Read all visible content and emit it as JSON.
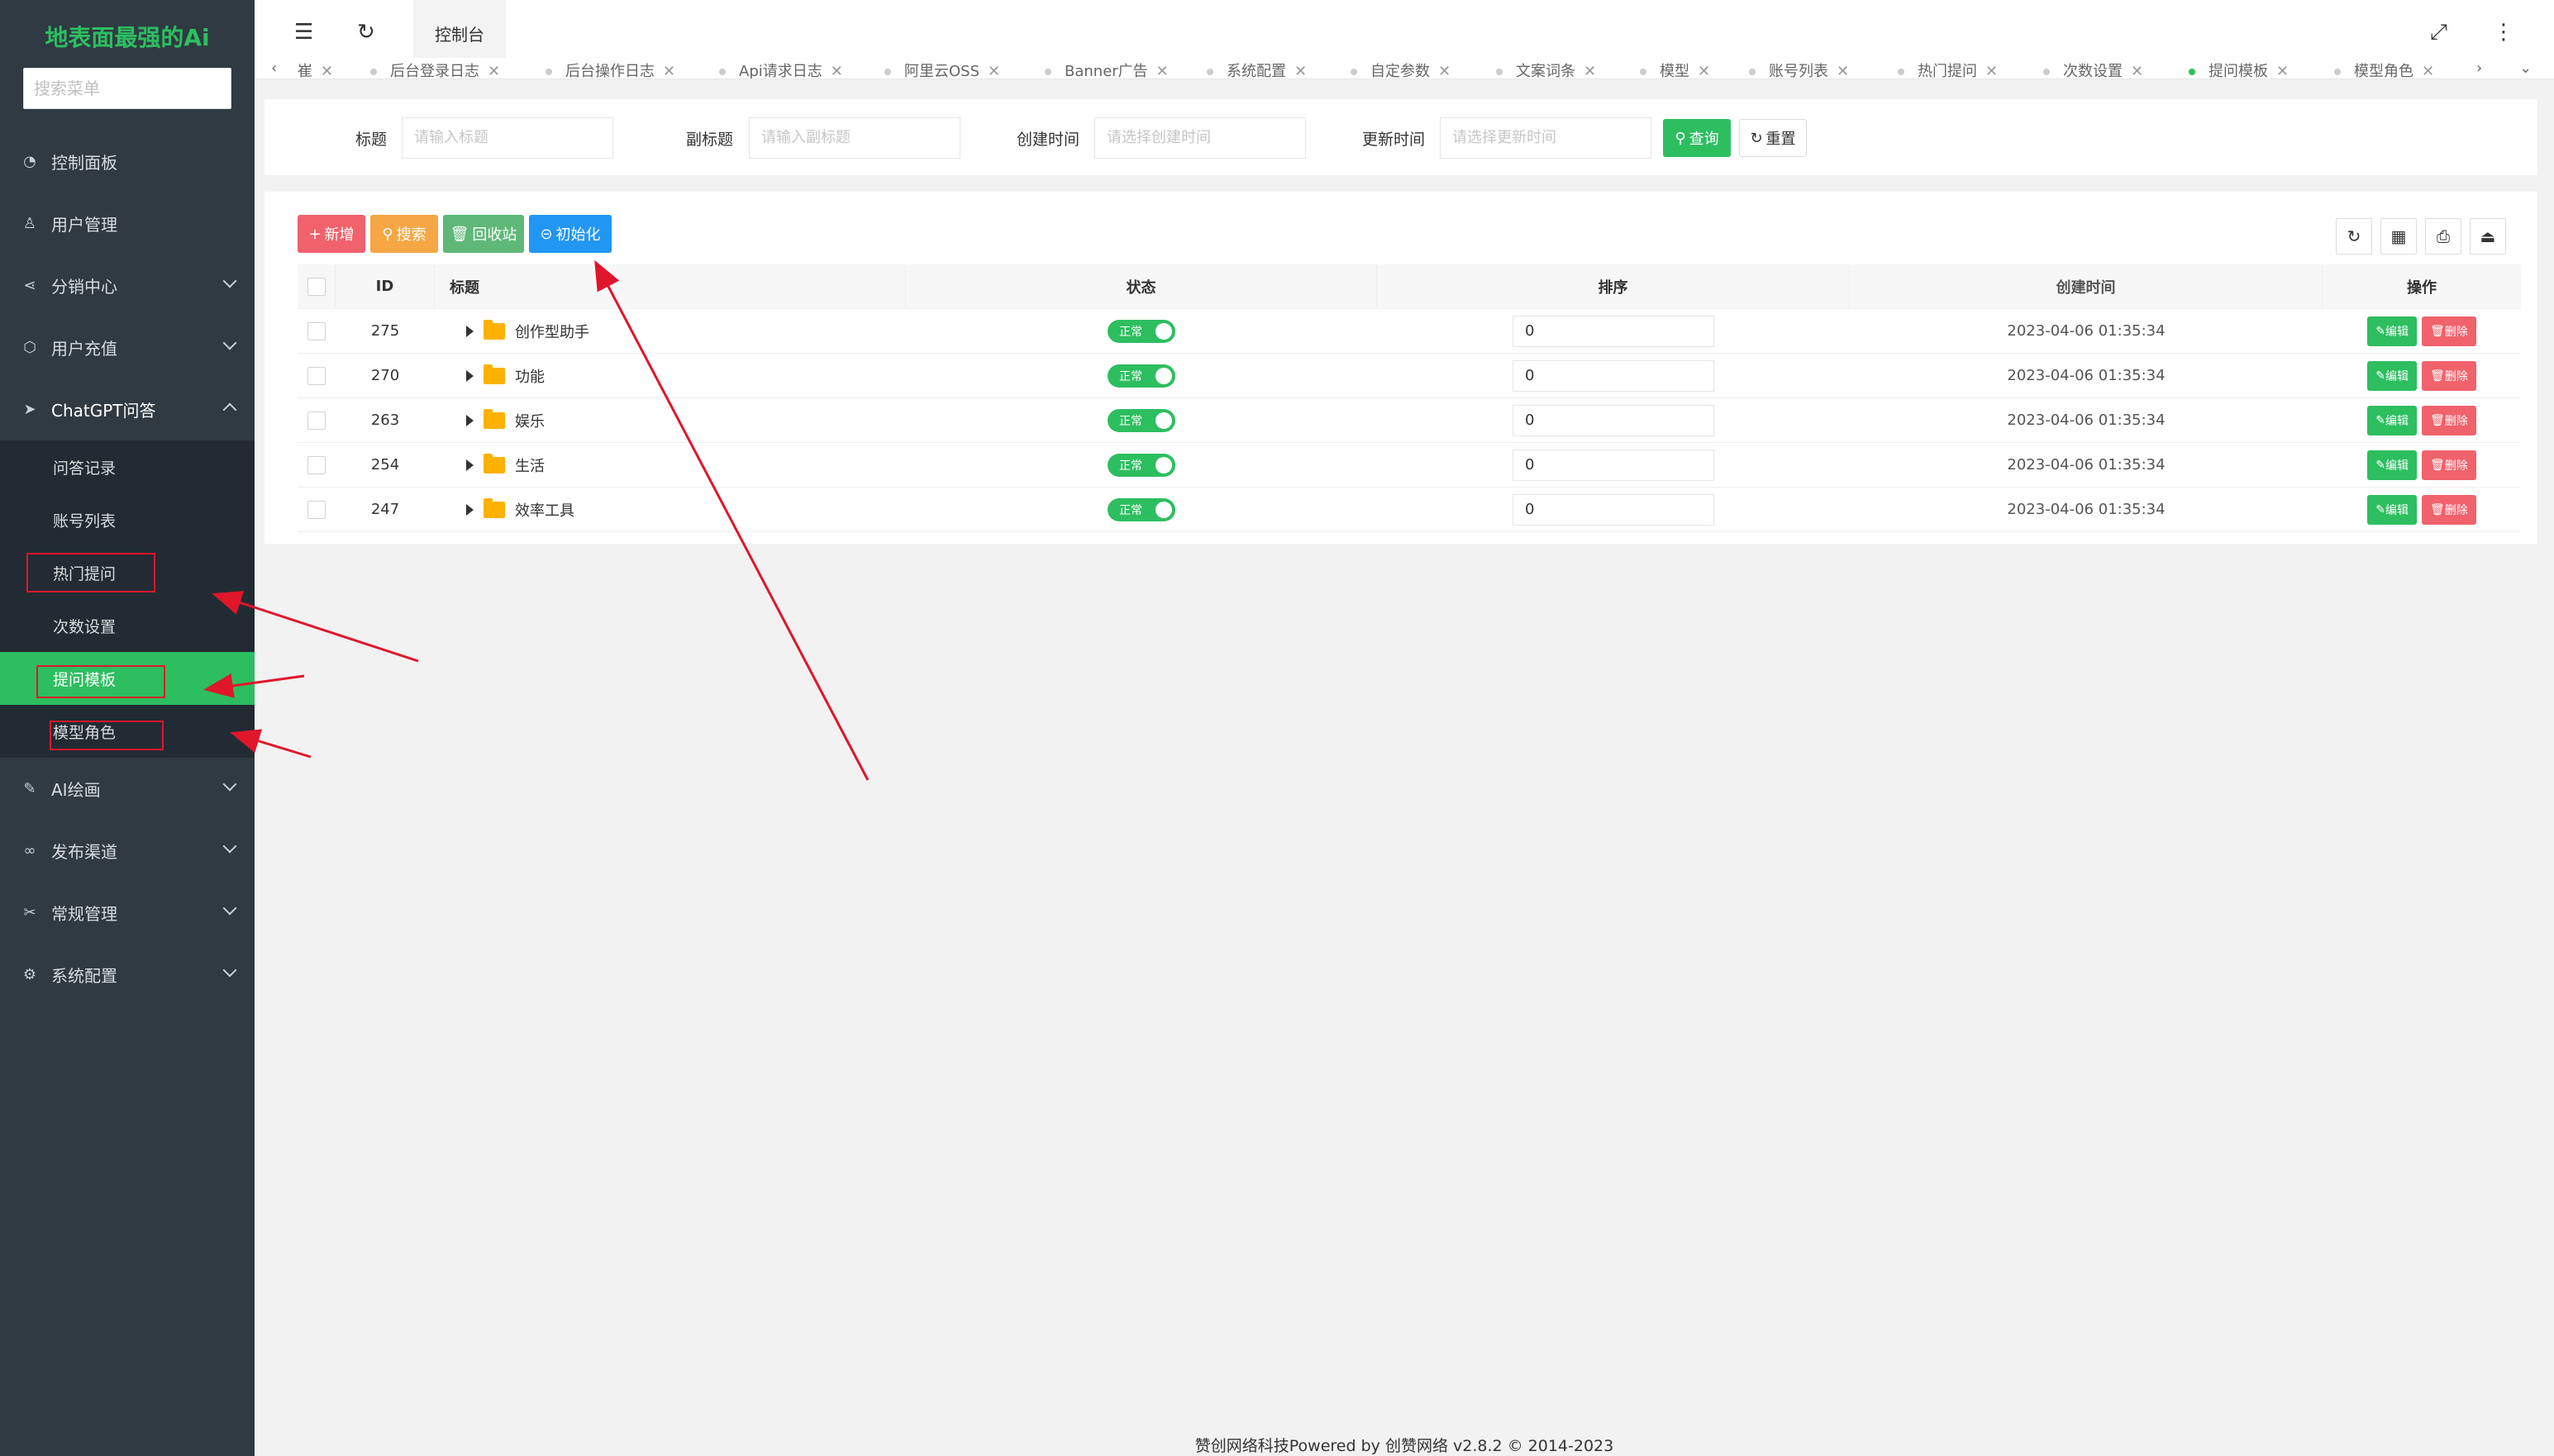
{
  "sidebar": {
    "logo": "地表面最强的Ai",
    "search_placeholder": "搜索菜单",
    "items": [
      {
        "label": "控制面板",
        "icon": "dashboard-icon"
      },
      {
        "label": "用户管理",
        "icon": "user-icon"
      },
      {
        "label": "分销中心",
        "icon": "share-icon"
      },
      {
        "label": "用户充值",
        "icon": "box-icon"
      },
      {
        "label": "ChatGPT问答",
        "icon": "send-icon"
      },
      {
        "label": "AI绘画",
        "icon": "brush-icon"
      },
      {
        "label": "发布渠道",
        "icon": "link-icon"
      },
      {
        "label": "常规管理",
        "icon": "tools-icon"
      },
      {
        "label": "系统配置",
        "icon": "gear-icon"
      }
    ],
    "sub_items": [
      {
        "label": "问答记录"
      },
      {
        "label": "账号列表"
      },
      {
        "label": "热门提问"
      },
      {
        "label": "次数设置"
      },
      {
        "label": "提问模板"
      },
      {
        "label": "模型角色"
      }
    ]
  },
  "topbar": {
    "active_tab": "控制台"
  },
  "tabstrip": {
    "tabs": [
      "崔",
      "后台登录日志",
      "后台操作日志",
      "Api请求日志",
      "阿里云OSS",
      "Banner广告",
      "系统配置",
      "自定参数",
      "文案词条",
      "模型",
      "账号列表",
      "热门提问",
      "次数设置",
      "提问模板",
      "模型角色"
    ]
  },
  "filters": {
    "title_label": "标题",
    "title_placeholder": "请输入标题",
    "subtitle_label": "副标题",
    "subtitle_placeholder": "请输入副标题",
    "created_label": "创建时间",
    "created_placeholder": "请选择创建时间",
    "updated_label": "更新时间",
    "updated_placeholder": "请选择更新时间",
    "query_btn": "查询",
    "reset_btn": "重置"
  },
  "toolbar": {
    "add": "新增",
    "search": "搜索",
    "recycle": "回收站",
    "init": "初始化"
  },
  "table": {
    "headers": {
      "id": "ID",
      "title": "标题",
      "status": "状态",
      "sort": "排序",
      "created": "创建时间",
      "op": "操作"
    },
    "rows": [
      {
        "id": "275",
        "title": "创作型助手",
        "status": "正常",
        "sort": "0",
        "created": "2023-04-06 01:35:34"
      },
      {
        "id": "270",
        "title": "功能",
        "status": "正常",
        "sort": "0",
        "created": "2023-04-06 01:35:34"
      },
      {
        "id": "263",
        "title": "娱乐",
        "status": "正常",
        "sort": "0",
        "created": "2023-04-06 01:35:34"
      },
      {
        "id": "254",
        "title": "生活",
        "status": "正常",
        "sort": "0",
        "created": "2023-04-06 01:35:34"
      },
      {
        "id": "247",
        "title": "效率工具",
        "status": "正常",
        "sort": "0",
        "created": "2023-04-06 01:35:34"
      }
    ],
    "edit": "编辑",
    "delete": "删除"
  },
  "footer": "赞创网络科技Powered by 创赞网络 v2.8.2 © 2014-2023",
  "colors": {
    "sidebar": "#2f3a43",
    "accent": "#2dbe60",
    "danger": "#f0626c",
    "warning": "#f4a744",
    "info": "#2196f3",
    "annotation": "#e0162b"
  }
}
